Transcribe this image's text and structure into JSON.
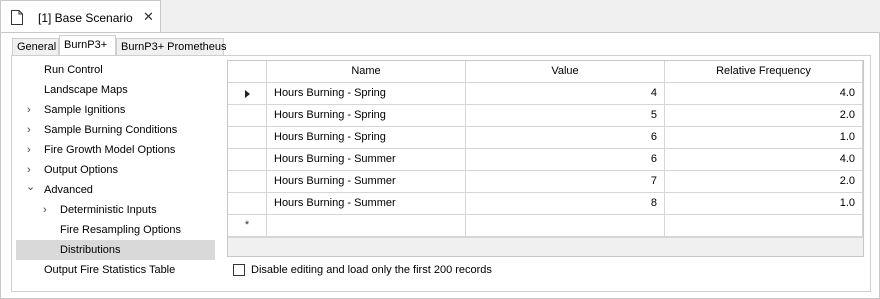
{
  "document_tab": {
    "title": "[1] Base Scenario",
    "close": "✕"
  },
  "tabs": [
    {
      "label": "General",
      "active": false
    },
    {
      "label": "BurnP3+",
      "active": true
    },
    {
      "label": "BurnP3+ Prometheus",
      "active": false
    }
  ],
  "tree": [
    {
      "label": "Run Control",
      "expander": ""
    },
    {
      "label": "Landscape Maps",
      "expander": ""
    },
    {
      "label": "Sample Ignitions",
      "expander": "›"
    },
    {
      "label": "Sample Burning Conditions",
      "expander": "›"
    },
    {
      "label": "Fire Growth Model Options",
      "expander": "›"
    },
    {
      "label": "Output Options",
      "expander": "›"
    },
    {
      "label": "Advanced",
      "expander": "⌄"
    },
    {
      "label": "Deterministic Inputs",
      "expander": "›"
    },
    {
      "label": "Fire Resampling Options",
      "expander": ""
    },
    {
      "label": "Distributions",
      "expander": "",
      "selected": true
    },
    {
      "label": "Output Fire Statistics Table",
      "expander": ""
    }
  ],
  "grid": {
    "columns": [
      "Name",
      "Value",
      "Relative Frequency"
    ],
    "rows": [
      {
        "name": "Hours Burning - Spring",
        "value": "4",
        "freq": "4.0"
      },
      {
        "name": "Hours Burning - Spring",
        "value": "5",
        "freq": "2.0"
      },
      {
        "name": "Hours Burning - Spring",
        "value": "6",
        "freq": "1.0"
      },
      {
        "name": "Hours Burning - Summer",
        "value": "6",
        "freq": "4.0"
      },
      {
        "name": "Hours Burning - Summer",
        "value": "7",
        "freq": "2.0"
      },
      {
        "name": "Hours Burning - Summer",
        "value": "8",
        "freq": "1.0"
      }
    ],
    "new_row_marker": "*"
  },
  "checkbox": {
    "label": "Disable editing and load only the first 200 records",
    "checked": false
  },
  "icons": {
    "document": "file-icon",
    "row_current": "row-pointer-icon"
  }
}
